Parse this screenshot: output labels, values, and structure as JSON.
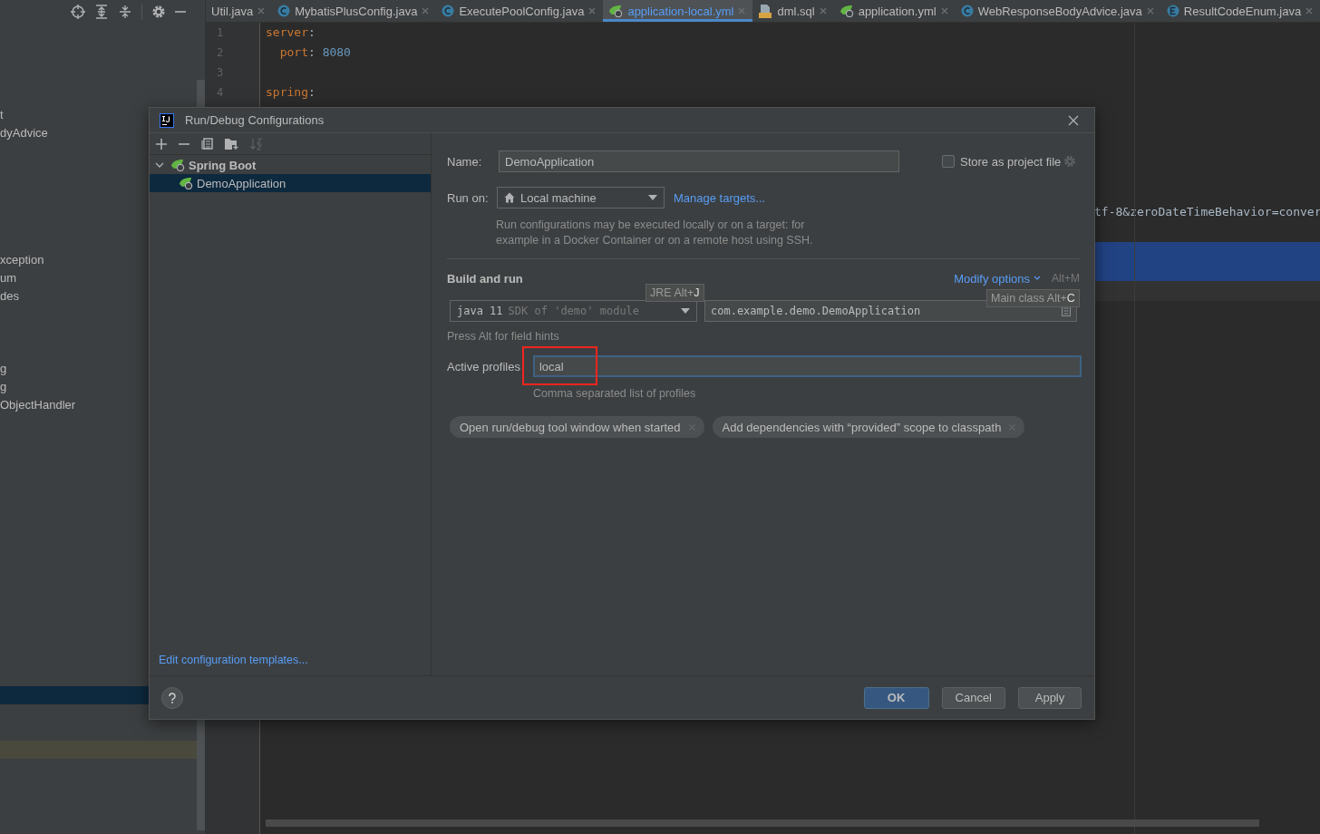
{
  "project_tree": {
    "items": [
      {
        "label": "t"
      },
      {
        "label": "dyAdvice"
      },
      {
        "label": "xception"
      },
      {
        "label": "um"
      },
      {
        "label": "des"
      },
      {
        "label": "g"
      },
      {
        "label": "g"
      },
      {
        "label": "ObjectHandler"
      }
    ]
  },
  "editor_tabs": [
    {
      "label": "Util.java",
      "kind": "none",
      "selected": false
    },
    {
      "label": "MybatisPlusConfig.java",
      "kind": "class",
      "selected": false
    },
    {
      "label": "ExecutePoolConfig.java",
      "kind": "class",
      "selected": false
    },
    {
      "label": "application-local.yml",
      "kind": "spring",
      "selected": true
    },
    {
      "label": "dml.sql",
      "kind": "sql",
      "selected": false
    },
    {
      "label": "application.yml",
      "kind": "spring",
      "selected": false
    },
    {
      "label": "WebResponseBodyAdvice.java",
      "kind": "class",
      "selected": false
    },
    {
      "label": "ResultCodeEnum.java",
      "kind": "enum",
      "selected": false
    }
  ],
  "editor": {
    "lines": [
      {
        "number": "1",
        "tokens": [
          {
            "kind": "key",
            "text": "server"
          },
          {
            "kind": "plain",
            "text": ":"
          }
        ]
      },
      {
        "number": "2",
        "tokens": [
          {
            "kind": "key",
            "text": "  port"
          },
          {
            "kind": "plain",
            "text": ": "
          },
          {
            "kind": "number",
            "text": "8080"
          }
        ]
      },
      {
        "number": "3"
      },
      {
        "number": "4",
        "tokens": [
          {
            "kind": "key",
            "text": "spring"
          },
          {
            "kind": "plain",
            "text": ":"
          }
        ]
      }
    ],
    "cut_line": "tf-8&zeroDateTimeBehavior=conver"
  },
  "dialog": {
    "title": "Run/Debug Configurations",
    "tree": [
      {
        "label": "Spring Boot",
        "expanded": true,
        "selected": false,
        "children": [
          {
            "label": "DemoApplication",
            "selected": true
          }
        ]
      }
    ],
    "templates_link": "Edit configuration templates...",
    "form": {
      "name_label": "Name:",
      "name_value": "DemoApplication",
      "store_label": "Store as project file",
      "store_checked": false,
      "run_on_label": "Run on:",
      "run_on_value": "Local machine",
      "manage_link": "Manage targets...",
      "run_on_hint": [
        "Run configurations may be executed locally or on a target: for",
        "example in a Docker Container or on a remote host using SSH."
      ],
      "section": "Build and run",
      "modify_link": "Modify options",
      "modify_shortcut": "Alt+M",
      "jre_value": "java 11",
      "jre_hint": "SDK of 'demo' module",
      "jre_tooltip": "JRE Alt+**J**",
      "main_class": "com.example.demo.DemoApplication",
      "main_class_tooltip": "Main class Alt+**C**",
      "alt_hint": "Press Alt for field hints",
      "profiles_label": "Active profiles",
      "profiles_value": "local",
      "profiles_hint": "Comma separated list of profiles",
      "options": [
        "Open run/debug tool window when started",
        "Add dependencies with “provided” scope to classpath"
      ]
    },
    "buttons": [
      {
        "label": "OK",
        "default": true
      },
      {
        "label": "Cancel",
        "default": false
      },
      {
        "label": "Apply",
        "default": false
      }
    ]
  }
}
